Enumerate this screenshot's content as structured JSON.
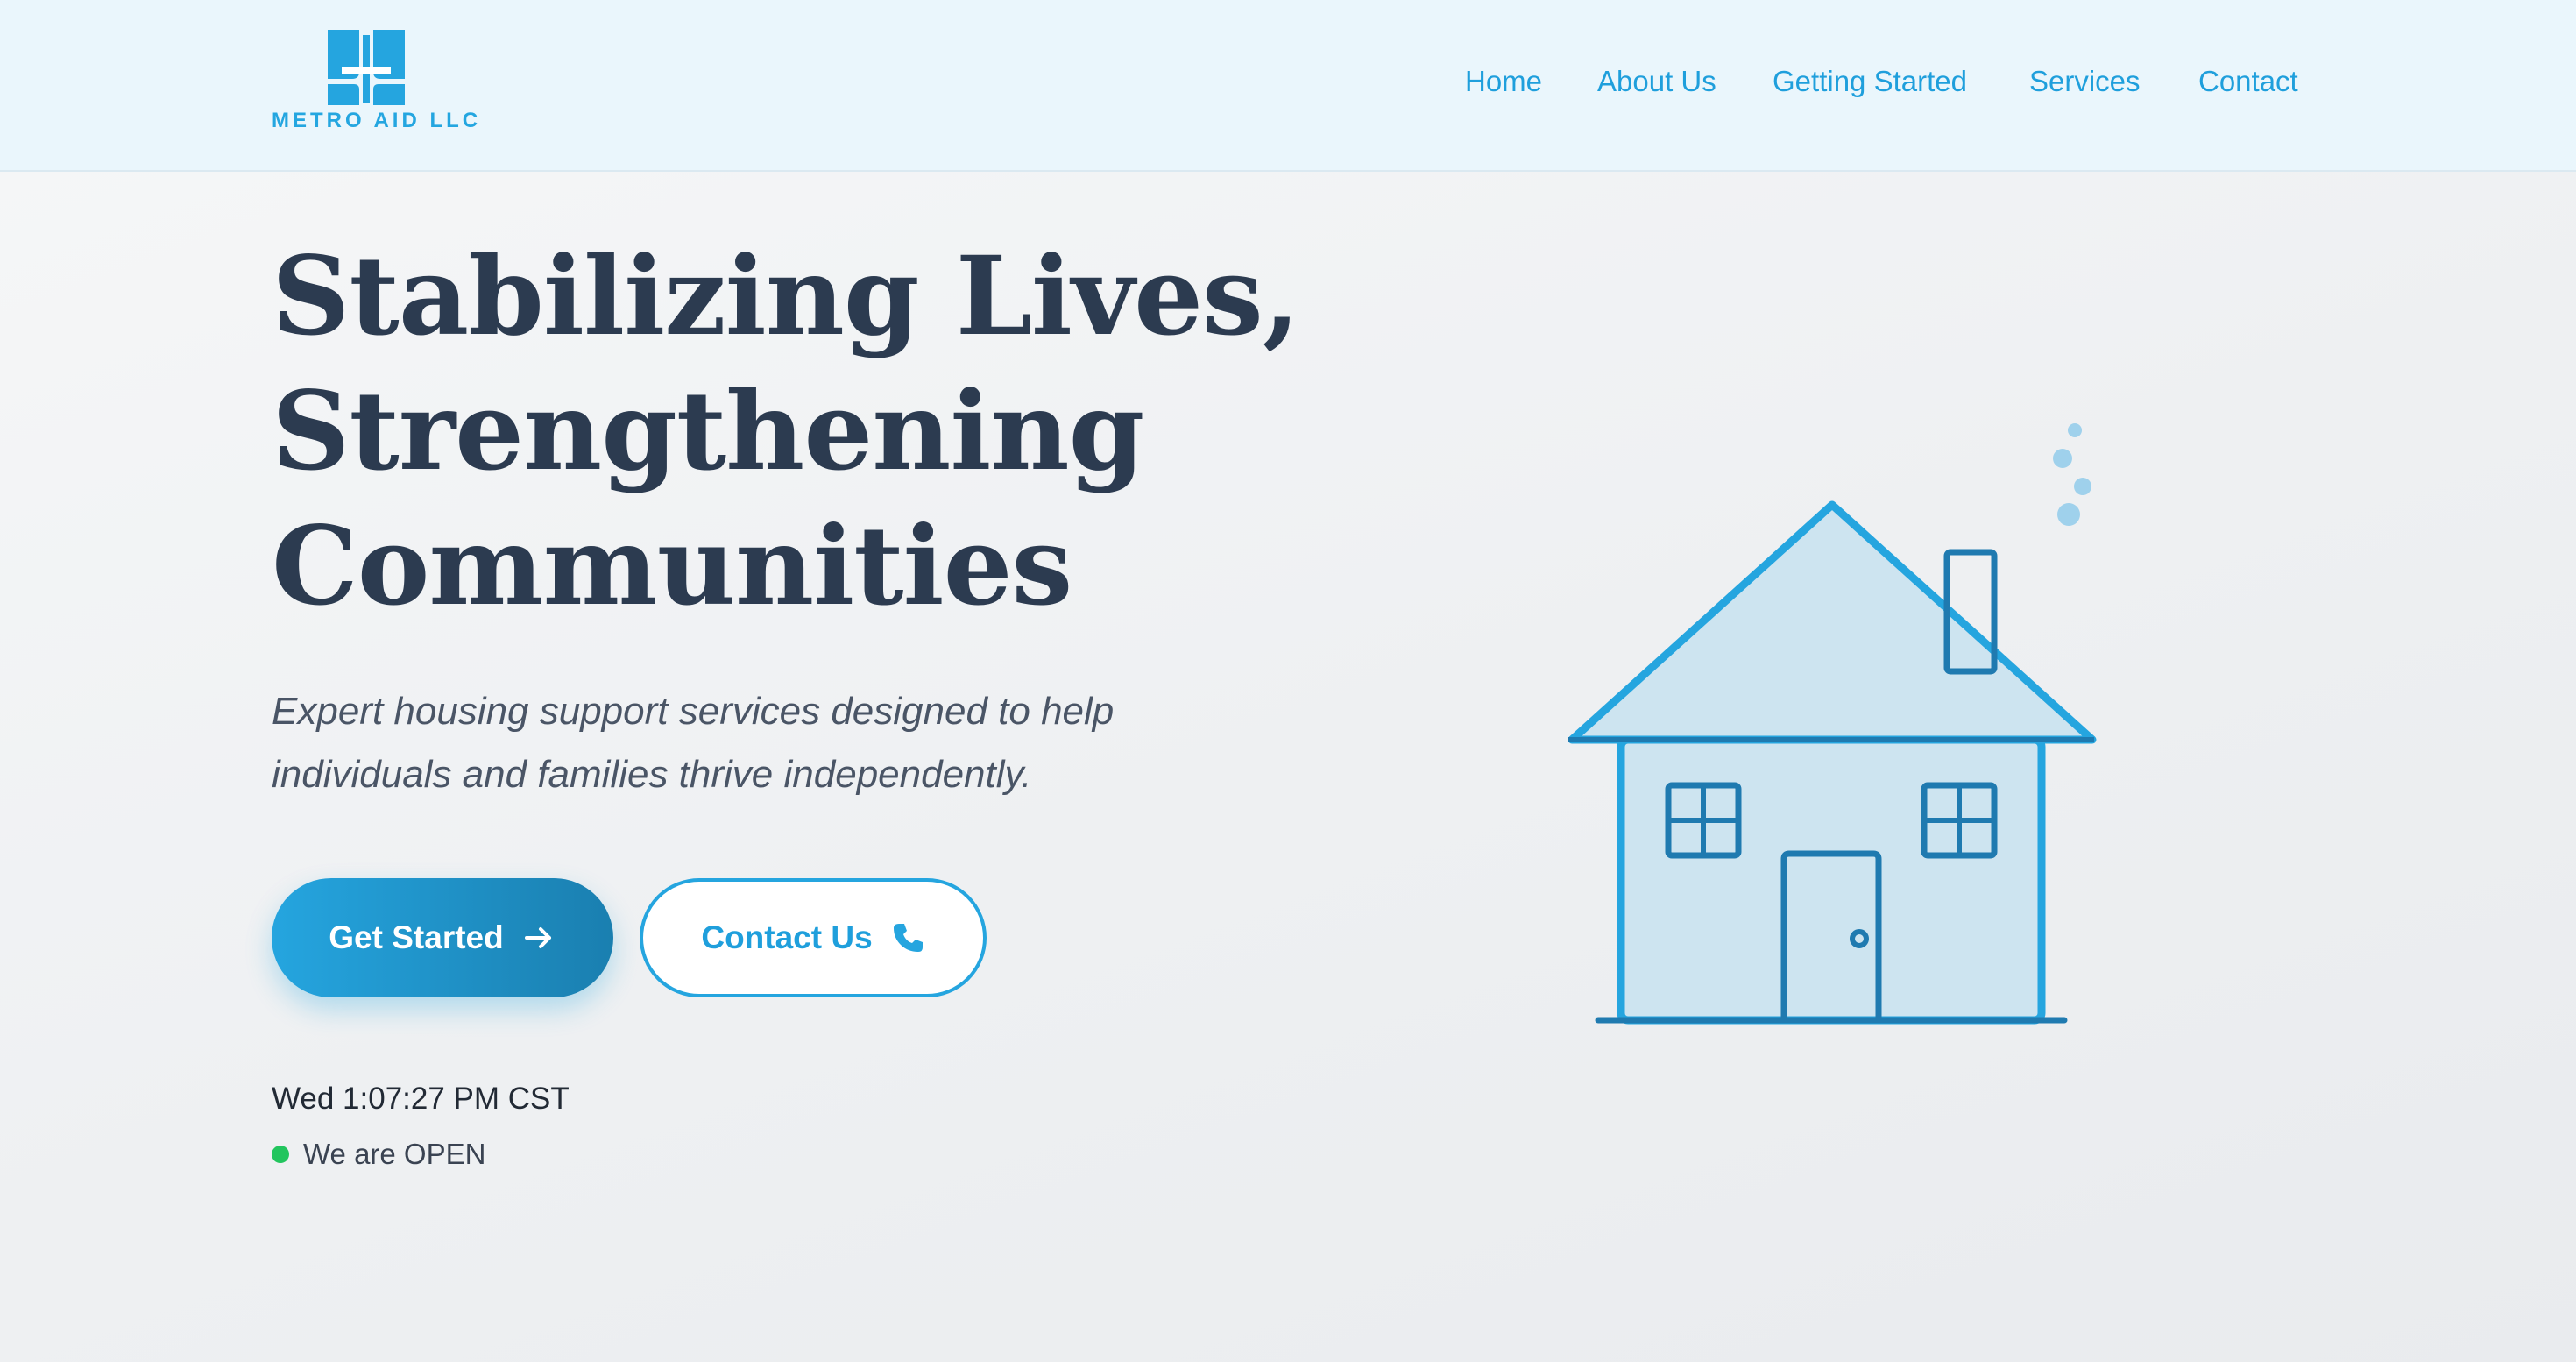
{
  "brand": {
    "name": "METRO AID LLC",
    "primary_color": "#25a5df",
    "dark_color": "#1a7fb0",
    "text_color": "#2c3b50"
  },
  "nav": {
    "items": [
      {
        "label": "Home"
      },
      {
        "label": "About Us"
      },
      {
        "label": "Getting Started"
      },
      {
        "label": "Services"
      },
      {
        "label": "Contact"
      }
    ]
  },
  "hero": {
    "title_lines": [
      "Stabilizing Lives,",
      "Strengthening",
      "Communities"
    ],
    "subtitle_lines": [
      "Expert housing support services designed to help",
      "individuals and families thrive independently."
    ],
    "primary_button": {
      "label": "Get Started",
      "icon": "arrow-right-icon"
    },
    "secondary_button": {
      "label": "Contact Us",
      "icon": "phone-icon"
    }
  },
  "status": {
    "clock": "Wed 1:07:27 PM CST",
    "open_text": "We are OPEN",
    "open_color": "#22c55e"
  },
  "illustration": {
    "icon": "house-icon"
  }
}
